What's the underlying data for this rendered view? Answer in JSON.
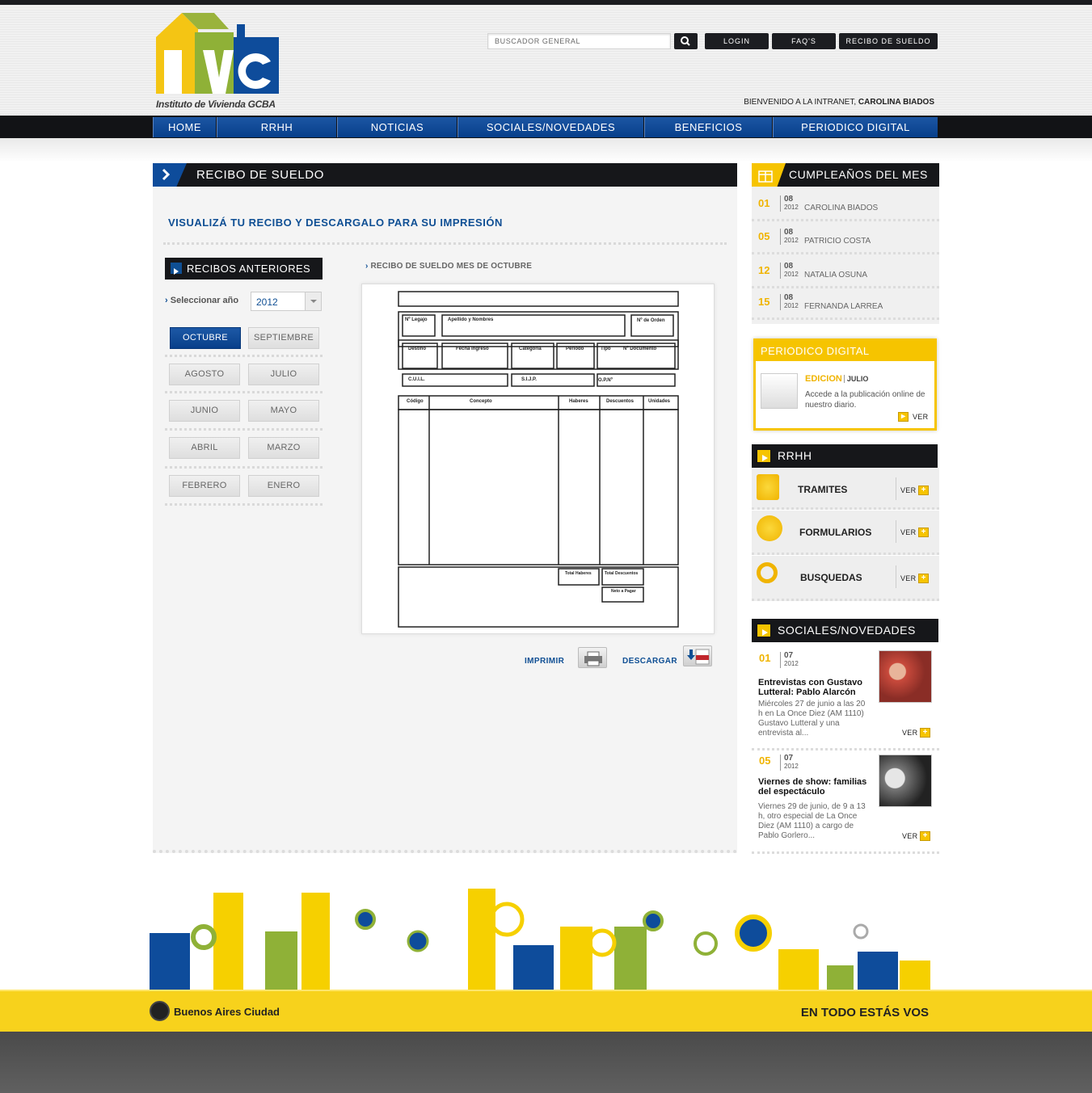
{
  "header": {
    "logo_text": "IVC",
    "logo_subtitle": "Instituto de Vivienda GCBA",
    "search_placeholder": "BUSCADOR GENERAL",
    "buttons": {
      "login": "LOGIN",
      "faqs": "FAQ'S",
      "recibo": "RECIBO DE SUELDO"
    },
    "welcome_prefix": "BIENVENIDO A LA INTRANET,",
    "welcome_user": "CAROLINA BIADOS"
  },
  "nav": [
    "HOME",
    "RRHH",
    "NOTICIAS",
    "SOCIALES/NOVEDADES",
    "BENEFICIOS",
    "PERIODICO DIGITAL"
  ],
  "main": {
    "section_title": "RECIBO DE SUELDO",
    "subheading": "VISUALIZÁ TU RECIBO Y DESCARGALO PARA SU IMPRESIÓN",
    "recibos_title": "RECIBOS ANTERIORES",
    "select_label": "Seleccionar año",
    "select_value": "2012",
    "months": [
      "OCTUBRE",
      "SEPTIEMBRE",
      "AGOSTO",
      "JULIO",
      "JUNIO",
      "MAYO",
      "ABRIL",
      "MARZO",
      "FEBRERO",
      "ENERO"
    ],
    "active_month": "OCTUBRE",
    "recibo_label": "RECIBO DE SUELDO MES DE OCTUBRE",
    "form_labels": {
      "legajo": "Nº Legajo",
      "apellido": "Apellido y Nombres",
      "orden": "Nº de Orden",
      "destino": "Destino",
      "fecha": "Fecha Ingreso",
      "categoria": "Categoría",
      "periodo": "Período",
      "tipo": "Tipo",
      "documento": "Nº Documento",
      "cuil": "C.U.I.L.",
      "sijp": "S.I.J.P.",
      "opn": "O.P.Nº",
      "codigo": "Código",
      "concepto": "Concepto",
      "haberes": "Haberes",
      "descuentos": "Descuentos",
      "unidades": "Unidades",
      "total_haberes": "Total Haberes",
      "total_descuentos": "Total Descuentos",
      "neto": "Neto a Pagar"
    },
    "imprimir": "IMPRIMIR",
    "descargar": "DESCARGAR"
  },
  "sidebar": {
    "cumple_title": "CUMPLEAÑOS DEL MES",
    "cumples": [
      {
        "day": "01",
        "month": "08",
        "year": "2012",
        "name": "CAROLINA BIADOS"
      },
      {
        "day": "05",
        "month": "08",
        "year": "2012",
        "name": "PATRICIO COSTA"
      },
      {
        "day": "12",
        "month": "08",
        "year": "2012",
        "name": "NATALIA OSUNA"
      },
      {
        "day": "15",
        "month": "08",
        "year": "2012",
        "name": "FERNANDA LARREA"
      }
    ],
    "periodico": {
      "title": "PERIODICO DIGITAL",
      "edicion": "EDICION",
      "mes": "JULIO",
      "desc": "Accede a la publicación online de nuestro diario.",
      "ver": "VER"
    },
    "rrhh_title": "RRHH",
    "rrhh": [
      {
        "label": "TRAMITES",
        "ver": "VER"
      },
      {
        "label": "FORMULARIOS",
        "ver": "VER"
      },
      {
        "label": "BUSQUEDAS",
        "ver": "VER"
      }
    ],
    "sociales_title": "SOCIALES/NOVEDADES",
    "sociales": [
      {
        "day": "01",
        "month": "07",
        "year": "2012",
        "title": "Entrevistas con Gustavo Lutteral: Pablo Alarcón",
        "text": "Miércoles 27 de junio a las 20 h en La Once Diez (AM 1110) Gustavo Lutteral y una entrevista al...",
        "ver": "VER"
      },
      {
        "day": "05",
        "month": "07",
        "year": "2012",
        "title": "Viernes de show: familias del espectáculo",
        "text": "Viernes 29 de junio, de 9 a 13 h, otro especial de La Once Diez (AM 1110) a cargo de Pablo Gorlero...",
        "ver": "VER"
      }
    ]
  },
  "footer": {
    "brand": "Buenos Aires Ciudad",
    "slogan": "EN TODO ESTÁS VOS"
  },
  "colors": {
    "blue": "#0f4f94",
    "yellow": "#f6c400",
    "dark": "#16171a"
  }
}
